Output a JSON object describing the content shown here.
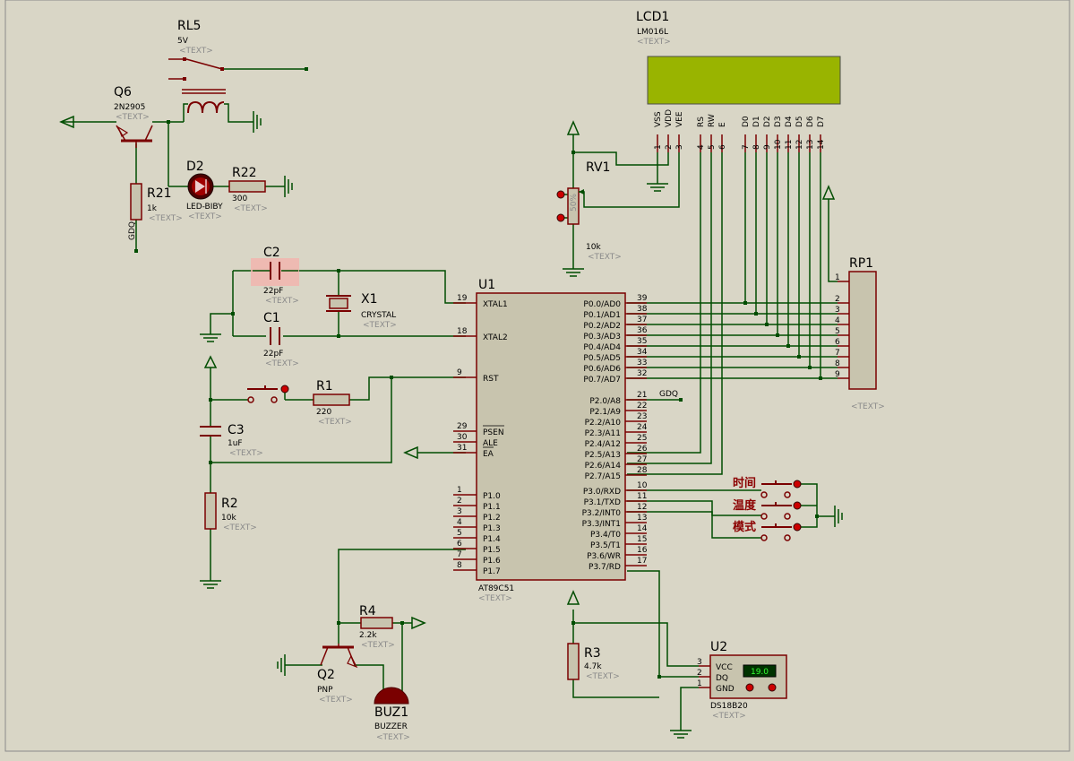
{
  "lcd": {
    "ref": "LCD1",
    "part": "LM016L",
    "text": "<TEXT>",
    "pins": [
      {
        "name": "VSS",
        "num": "1"
      },
      {
        "name": "VDD",
        "num": "2"
      },
      {
        "name": "VEE",
        "num": "3"
      },
      {
        "name": "RS",
        "num": "4"
      },
      {
        "name": "RW",
        "num": "5"
      },
      {
        "name": "E",
        "num": "6"
      },
      {
        "name": "D0",
        "num": "7"
      },
      {
        "name": "D1",
        "num": "8"
      },
      {
        "name": "D2",
        "num": "9"
      },
      {
        "name": "D3",
        "num": "10"
      },
      {
        "name": "D4",
        "num": "11"
      },
      {
        "name": "D5",
        "num": "12"
      },
      {
        "name": "D6",
        "num": "13"
      },
      {
        "name": "D7",
        "num": "14"
      }
    ]
  },
  "rl5": {
    "ref": "RL5",
    "value": "5V",
    "text": "<TEXT>"
  },
  "q6": {
    "ref": "Q6",
    "part": "2N2905",
    "text": "<TEXT>"
  },
  "d2": {
    "ref": "D2",
    "part": "LED-BIBY",
    "text": "<TEXT>"
  },
  "r22": {
    "ref": "R22",
    "value": "300",
    "text": "<TEXT>"
  },
  "r21": {
    "ref": "R21",
    "value": "1k",
    "text": "<TEXT>",
    "net": "GDQ"
  },
  "c2": {
    "ref": "C2",
    "value": "22pF",
    "text": "<TEXT>"
  },
  "c1": {
    "ref": "C1",
    "value": "22pF",
    "text": "<TEXT>"
  },
  "x1": {
    "ref": "X1",
    "part": "CRYSTAL",
    "text": "<TEXT>"
  },
  "rv1": {
    "ref": "RV1",
    "value": "10k",
    "text": "<TEXT>",
    "inner": "50%"
  },
  "r1": {
    "ref": "R1",
    "value": "220",
    "text": "<TEXT>"
  },
  "c3": {
    "ref": "C3",
    "value": "1uF",
    "text": "<TEXT>"
  },
  "r2": {
    "ref": "R2",
    "value": "10k",
    "text": "<TEXT>"
  },
  "r4": {
    "ref": "R4",
    "value": "2.2k",
    "text": "<TEXT>"
  },
  "q2": {
    "ref": "Q2",
    "part": "PNP",
    "text": "<TEXT>"
  },
  "buz1": {
    "ref": "BUZ1",
    "part": "BUZZER",
    "text": "<TEXT>"
  },
  "r3": {
    "ref": "R3",
    "value": "4.7k",
    "text": "<TEXT>"
  },
  "u2": {
    "ref": "U2",
    "part": "DS18B20",
    "text": "<TEXT>",
    "reading": "19.0",
    "pins": [
      {
        "name": "VCC",
        "num": "3"
      },
      {
        "name": "DQ",
        "num": "2"
      },
      {
        "name": "GND",
        "num": "1"
      }
    ]
  },
  "rp1": {
    "ref": "RP1",
    "text": "<TEXT>",
    "pins": [
      "1",
      "2",
      "3",
      "4",
      "5",
      "6",
      "7",
      "8",
      "9"
    ]
  },
  "u1": {
    "ref": "U1",
    "part": "AT89C51",
    "text": "<TEXT>",
    "left_pins": [
      {
        "name": "XTAL1",
        "num": "19"
      },
      {
        "name": "XTAL2",
        "num": "18"
      },
      {
        "name": "RST",
        "num": "9"
      },
      {
        "name": "PSEN",
        "num": "29"
      },
      {
        "name": "ALE",
        "num": "30"
      },
      {
        "name": "EA",
        "num": "31"
      },
      {
        "name": "P1.0",
        "num": "1"
      },
      {
        "name": "P1.1",
        "num": "2"
      },
      {
        "name": "P1.2",
        "num": "3"
      },
      {
        "name": "P1.3",
        "num": "4"
      },
      {
        "name": "P1.4",
        "num": "5"
      },
      {
        "name": "P1.5",
        "num": "6"
      },
      {
        "name": "P1.6",
        "num": "7"
      },
      {
        "name": "P1.7",
        "num": "8"
      }
    ],
    "right_pins": [
      {
        "name": "P0.0/AD0",
        "num": "39"
      },
      {
        "name": "P0.1/AD1",
        "num": "38"
      },
      {
        "name": "P0.2/AD2",
        "num": "37"
      },
      {
        "name": "P0.3/AD3",
        "num": "36"
      },
      {
        "name": "P0.4/AD4",
        "num": "35"
      },
      {
        "name": "P0.5/AD5",
        "num": "34"
      },
      {
        "name": "P0.6/AD6",
        "num": "33"
      },
      {
        "name": "P0.7/AD7",
        "num": "32"
      },
      {
        "name": "P2.0/A8",
        "num": "21"
      },
      {
        "name": "P2.1/A9",
        "num": "22"
      },
      {
        "name": "P2.2/A10",
        "num": "23"
      },
      {
        "name": "P2.3/A11",
        "num": "24"
      },
      {
        "name": "P2.4/A12",
        "num": "25"
      },
      {
        "name": "P2.5/A13",
        "num": "26"
      },
      {
        "name": "P2.6/A14",
        "num": "27"
      },
      {
        "name": "P2.7/A15",
        "num": "28"
      },
      {
        "name": "P3.0/RXD",
        "num": "10"
      },
      {
        "name": "P3.1/TXD",
        "num": "11"
      },
      {
        "name": "P3.2/INT0",
        "num": "12"
      },
      {
        "name": "P3.3/INT1",
        "num": "13"
      },
      {
        "name": "P3.4/T0",
        "num": "14"
      },
      {
        "name": "P3.5/T1",
        "num": "15"
      },
      {
        "name": "P3.6/WR",
        "num": "16"
      },
      {
        "name": "P3.7/RD",
        "num": "17"
      }
    ],
    "net_p20": "GDQ"
  },
  "buttons": {
    "time": "时间",
    "temp": "温度",
    "mode": "模式"
  },
  "colors": {
    "wire": "#004d00",
    "outline": "#7a0000",
    "chip_fill": "#c8c4ae",
    "lcd_fill": "#99b400",
    "highlight": "#f2b3ac"
  }
}
